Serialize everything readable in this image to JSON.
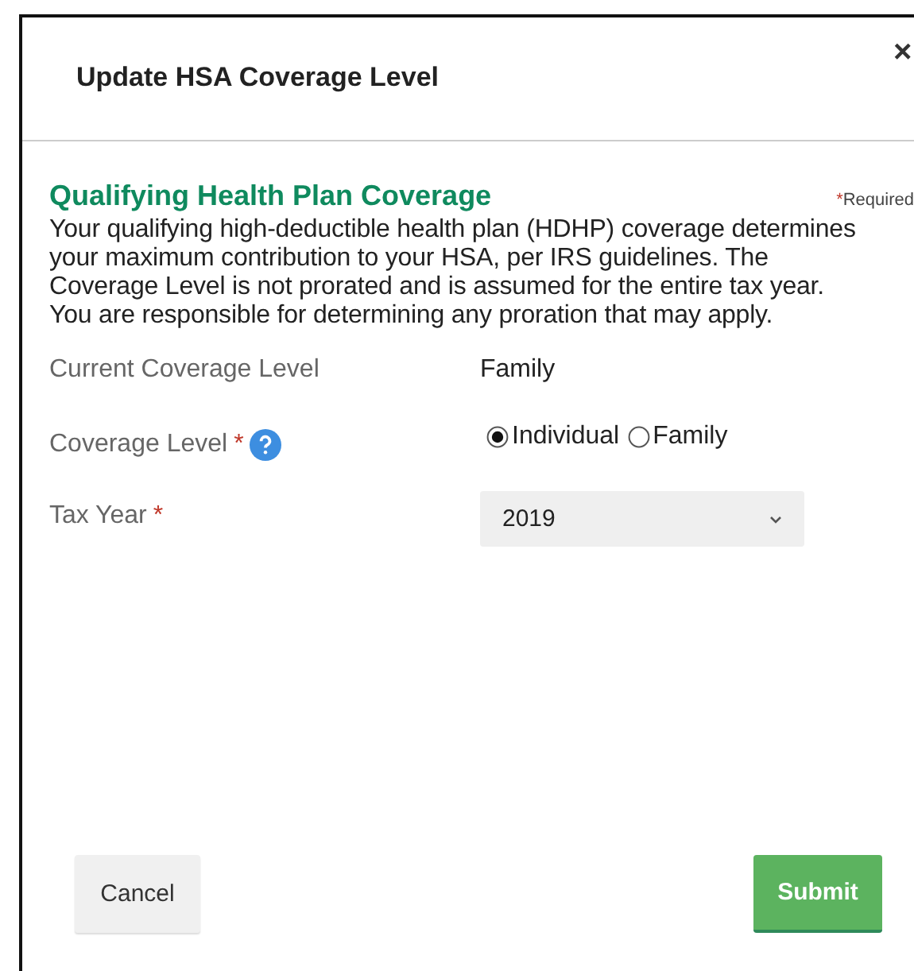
{
  "dialog": {
    "title": "Update HSA Coverage Level",
    "close": "×"
  },
  "section": {
    "heading": "Qualifying Health Plan Coverage",
    "required_mark": "*",
    "required_label": "Required",
    "description": "Your qualifying high-deductible health plan (HDHP) coverage determines your maximum contribution to your HSA, per IRS guidelines. The Coverage Level is not prorated and is assumed for the entire tax year. You are responsible for determining any proration that may apply."
  },
  "fields": [
    {
      "kind": "text",
      "label": "Current Coverage Level",
      "required": false,
      "help": false,
      "value": "Family"
    },
    {
      "kind": "radio",
      "label": "Coverage Level",
      "required": true,
      "help": true,
      "options": [
        {
          "label": "Individual",
          "selected": true
        },
        {
          "label": "Family",
          "selected": false
        }
      ]
    },
    {
      "kind": "select",
      "label": "Tax Year",
      "required": true,
      "help": false,
      "value": "2019"
    }
  ],
  "buttons": [
    {
      "label": "Cancel",
      "kind": "secondary"
    },
    {
      "label": "Submit",
      "kind": "primary"
    }
  ]
}
